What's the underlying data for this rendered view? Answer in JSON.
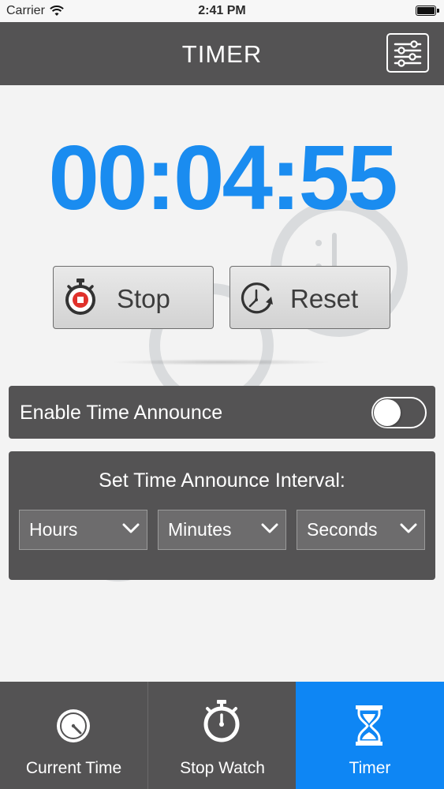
{
  "status_bar": {
    "carrier": "Carrier",
    "time": "2:41 PM"
  },
  "nav": {
    "title": "TIMER"
  },
  "timer": {
    "display": "00:04:55"
  },
  "controls": {
    "stop_label": "Stop",
    "reset_label": "Reset"
  },
  "announce": {
    "label": "Enable Time Announce",
    "enabled": false
  },
  "interval": {
    "title": "Set Time Announce Interval:",
    "hours": "Hours",
    "minutes": "Minutes",
    "seconds": "Seconds"
  },
  "tabs": [
    {
      "label": "Current Time",
      "icon": "clock-icon",
      "active": false
    },
    {
      "label": "Stop Watch",
      "icon": "stopwatch-icon",
      "active": false
    },
    {
      "label": "Timer",
      "icon": "hourglass-icon",
      "active": true
    }
  ],
  "colors": {
    "accent": "#1a8cf0",
    "active_tab": "#0e86f4",
    "panel": "#545354",
    "stop_red": "#e0312b"
  }
}
